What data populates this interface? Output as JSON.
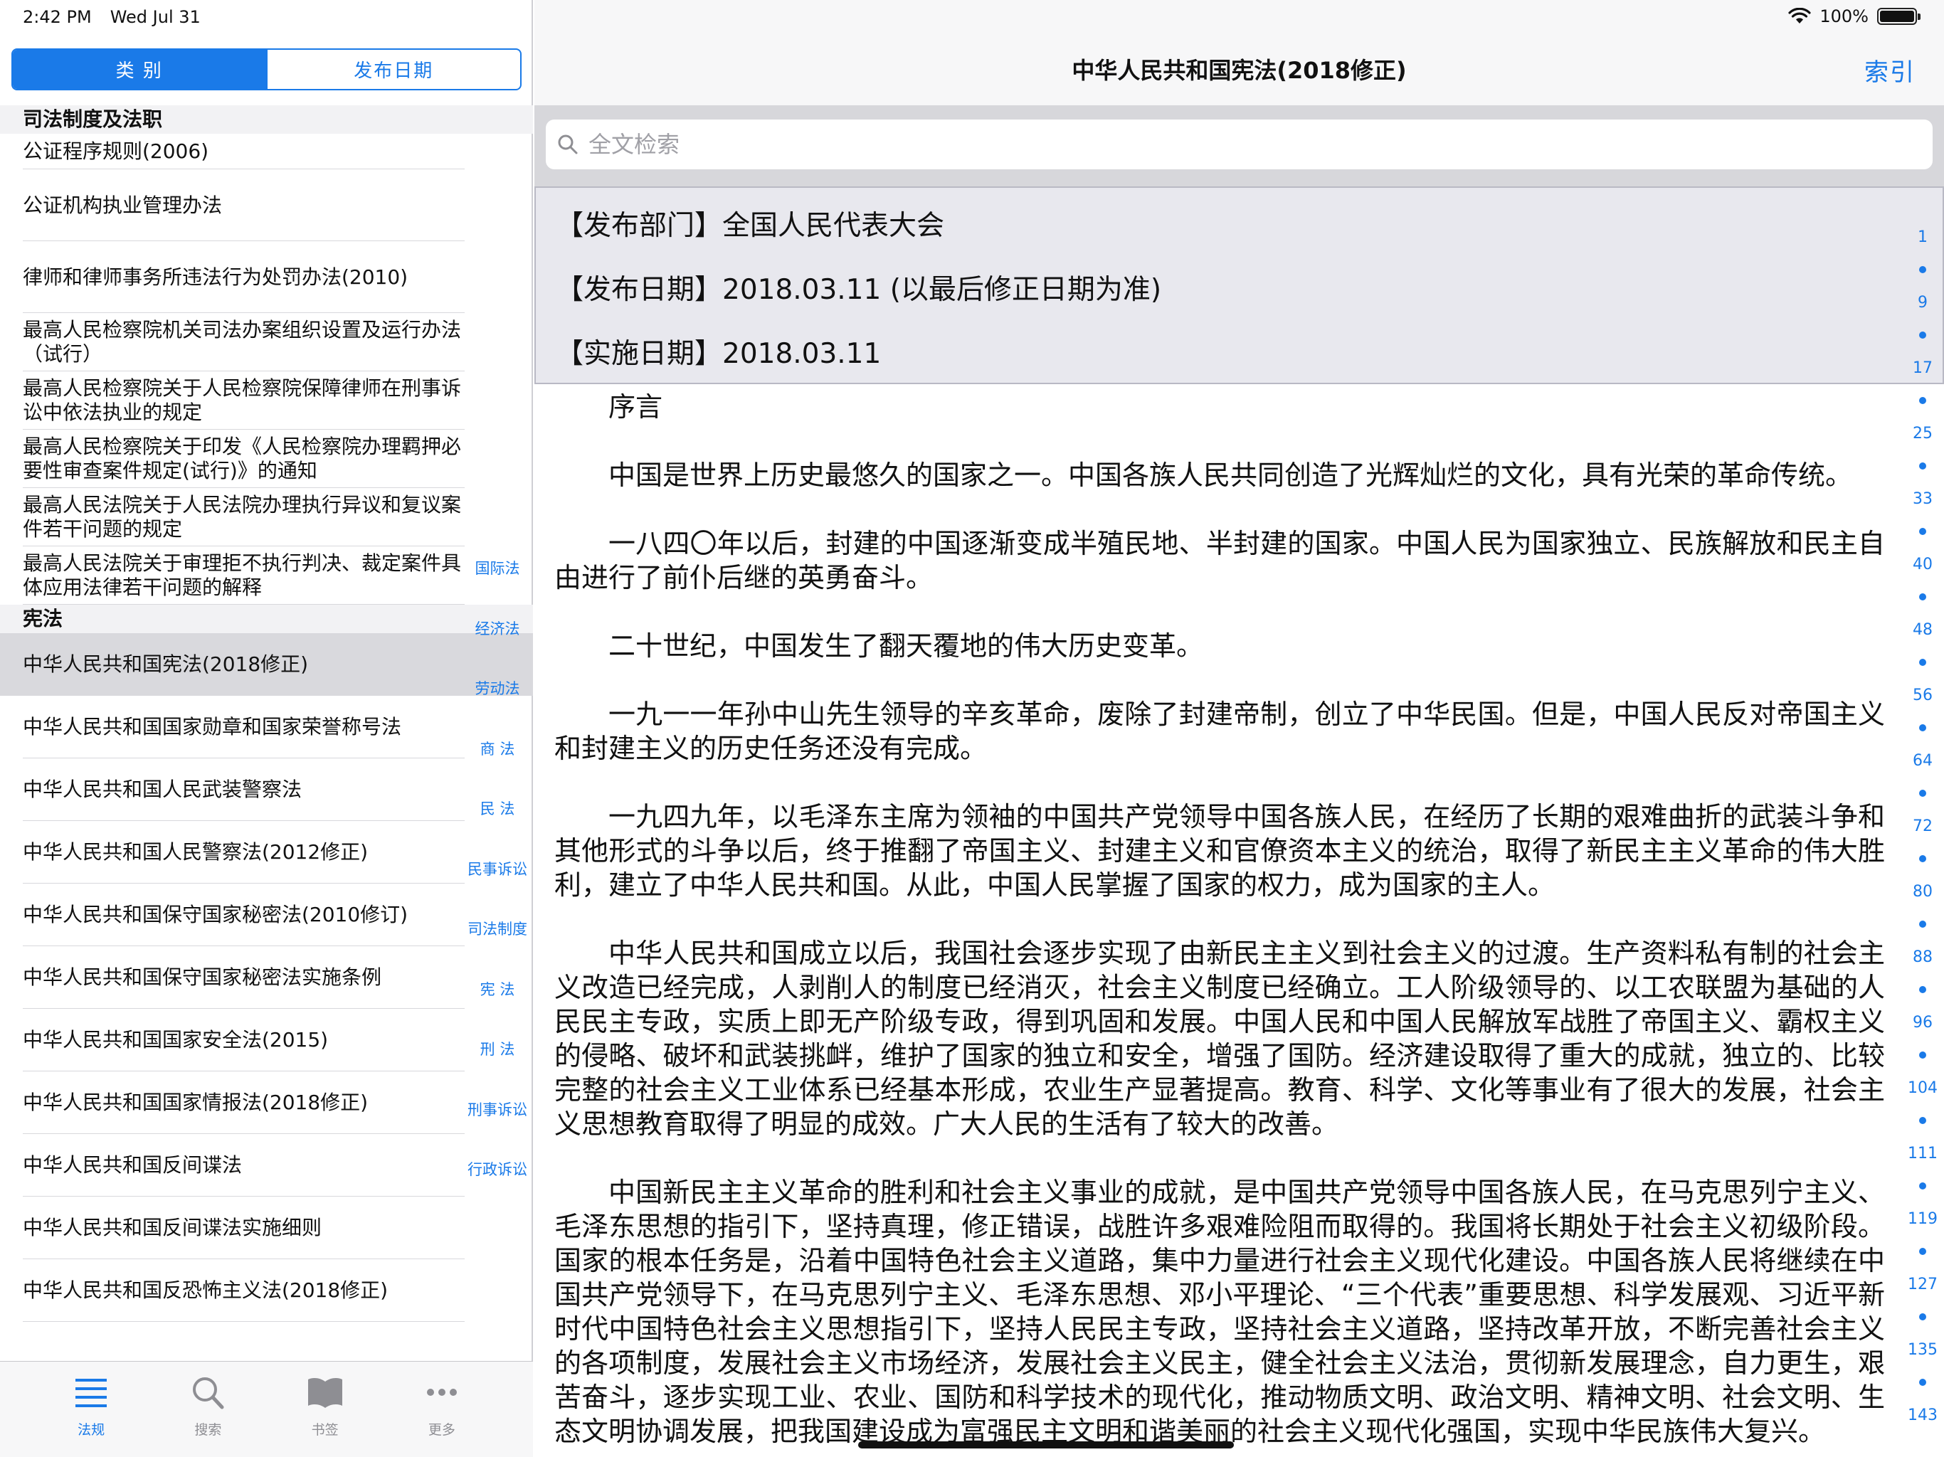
{
  "status_bar": {
    "time": "2:42 PM",
    "date": "Wed Jul 31",
    "battery": "100%",
    "battery_level": 1.0
  },
  "segments": [
    {
      "label": "类 别",
      "active": true
    },
    {
      "label": "发布日期",
      "active": false
    }
  ],
  "list": {
    "sections": [
      {
        "header": "司法制度及法职",
        "items": [
          "公证程序规则(2006)",
          "公证机构执业管理办法",
          "律师和律师事务所违法行为处罚办法(2010)",
          "最高人民检察院机关司法办案组织设置及运行办法（试行）",
          "最高人民检察院关于人民检察院保障律师在刑事诉讼中依法执业的规定",
          "最高人民检察院关于印发《人民检察院办理羁押必要性审查案件规定(试行)》的通知",
          "最高人民法院关于人民法院办理执行异议和复议案件若干问题的规定",
          "最高人民法院关于审理拒不执行判决、裁定案件具体应用法律若干问题的解释"
        ]
      },
      {
        "header": "宪法",
        "items": [
          "中华人民共和国宪法(2018修正)",
          "中华人民共和国国家勋章和国家荣誉称号法",
          "中华人民共和国人民武装警察法",
          "中华人民共和国人民警察法(2012修正)",
          "中华人民共和国保守国家秘密法(2010修订)",
          "中华人民共和国保守国家秘密法实施条例",
          "中华人民共和国国家安全法(2015)",
          "中华人民共和国国家情报法(2018修正)",
          "中华人民共和国反间谍法",
          "中华人民共和国反间谍法实施细则",
          "中华人民共和国反恐怖主义法(2018修正)"
        ]
      }
    ],
    "selected": "中华人民共和国宪法(2018修正)"
  },
  "category_index": [
    "国际法",
    "经济法",
    "劳动法",
    "商 法",
    "民 法",
    "民事诉讼",
    "司法制度",
    "宪 法",
    "刑 法",
    "刑事诉讼",
    "行政诉讼"
  ],
  "tab_bar": [
    {
      "label": "法规",
      "icon": "list-icon",
      "active": true
    },
    {
      "label": "搜索",
      "icon": "search-icon",
      "active": false
    },
    {
      "label": "书签",
      "icon": "book-icon",
      "active": false
    },
    {
      "label": "更多",
      "icon": "more-icon",
      "active": false
    }
  ],
  "nav": {
    "title": "中华人民共和国宪法(2018修正)",
    "index_button": "索引"
  },
  "search": {
    "placeholder": "全文检索",
    "value": ""
  },
  "meta": {
    "department": "【发布部门】全国人民代表大会",
    "publish_date": "【发布日期】2018.03.11 (以最后修正日期为准)",
    "effective_date": "【实施日期】2018.03.11"
  },
  "content": [
    "序言",
    "中国是世界上历史最悠久的国家之一。中国各族人民共同创造了光辉灿烂的文化，具有光荣的革命传统。",
    "一八四〇年以后，封建的中国逐渐变成半殖民地、半封建的国家。中国人民为国家独立、民族解放和民主自由进行了前仆后继的英勇奋斗。",
    "二十世纪，中国发生了翻天覆地的伟大历史变革。",
    "一九一一年孙中山先生领导的辛亥革命，废除了封建帝制，创立了中华民国。但是，中国人民反对帝国主义和封建主义的历史任务还没有完成。",
    "一九四九年，以毛泽东主席为领袖的中国共产党领导中国各族人民，在经历了长期的艰难曲折的武装斗争和其他形式的斗争以后，终于推翻了帝国主义、封建主义和官僚资本主义的统治，取得了新民主主义革命的伟大胜利，建立了中华人民共和国。从此，中国人民掌握了国家的权力，成为国家的主人。",
    "中华人民共和国成立以后，我国社会逐步实现了由新民主主义到社会主义的过渡。生产资料私有制的社会主义改造已经完成，人剥削人的制度已经消灭，社会主义制度已经确立。工人阶级领导的、以工农联盟为基础的人民民主专政，实质上即无产阶级专政，得到巩固和发展。中国人民和中国人民解放军战胜了帝国主义、霸权主义的侵略、破坏和武装挑衅，维护了国家的独立和安全，增强了国防。经济建设取得了重大的成就，独立的、比较完整的社会主义工业体系已经基本形成，农业生产显著提高。教育、科学、文化等事业有了很大的发展，社会主义思想教育取得了明显的成效。广大人民的生活有了较大的改善。",
    "中国新民主主义革命的胜利和社会主义事业的成就，是中国共产党领导中国各族人民，在马克思列宁主义、毛泽东思想的指引下，坚持真理，修正错误，战胜许多艰难险阻而取得的。我国将长期处于社会主义初级阶段。国家的根本任务是，沿着中国特色社会主义道路，集中力量进行社会主义现代化建设。中国各族人民将继续在中国共产党领导下，在马克思列宁主义、毛泽东思想、邓小平理论、“三个代表”重要思想、科学发展观、习近平新时代中国特色社会主义思想指引下，坚持人民民主专政，坚持社会主义道路，坚持改革开放，不断完善社会主义的各项制度，发展社会主义市场经济，发展社会主义民主，健全社会主义法治，贯彻新发展理念，自力更生，艰苦奋斗，逐步实现工业、农业、国防和科学技术的现代化，推动物质文明、政治文明、精神文明、社会文明、生态文明协调发展，把我国建设成为富强民主文明和谐美丽的社会主义现代化强国，实现中华民族伟大复兴。"
  ],
  "article_index": [
    "1",
    "9",
    "17",
    "25",
    "33",
    "40",
    "48",
    "56",
    "64",
    "72",
    "80",
    "88",
    "96",
    "104",
    "111",
    "119",
    "127",
    "135",
    "143"
  ],
  "colors": {
    "accent": "#1a7ae8",
    "selected_row": "#d9d9dd",
    "meta_bg": "#e8e8ee"
  }
}
